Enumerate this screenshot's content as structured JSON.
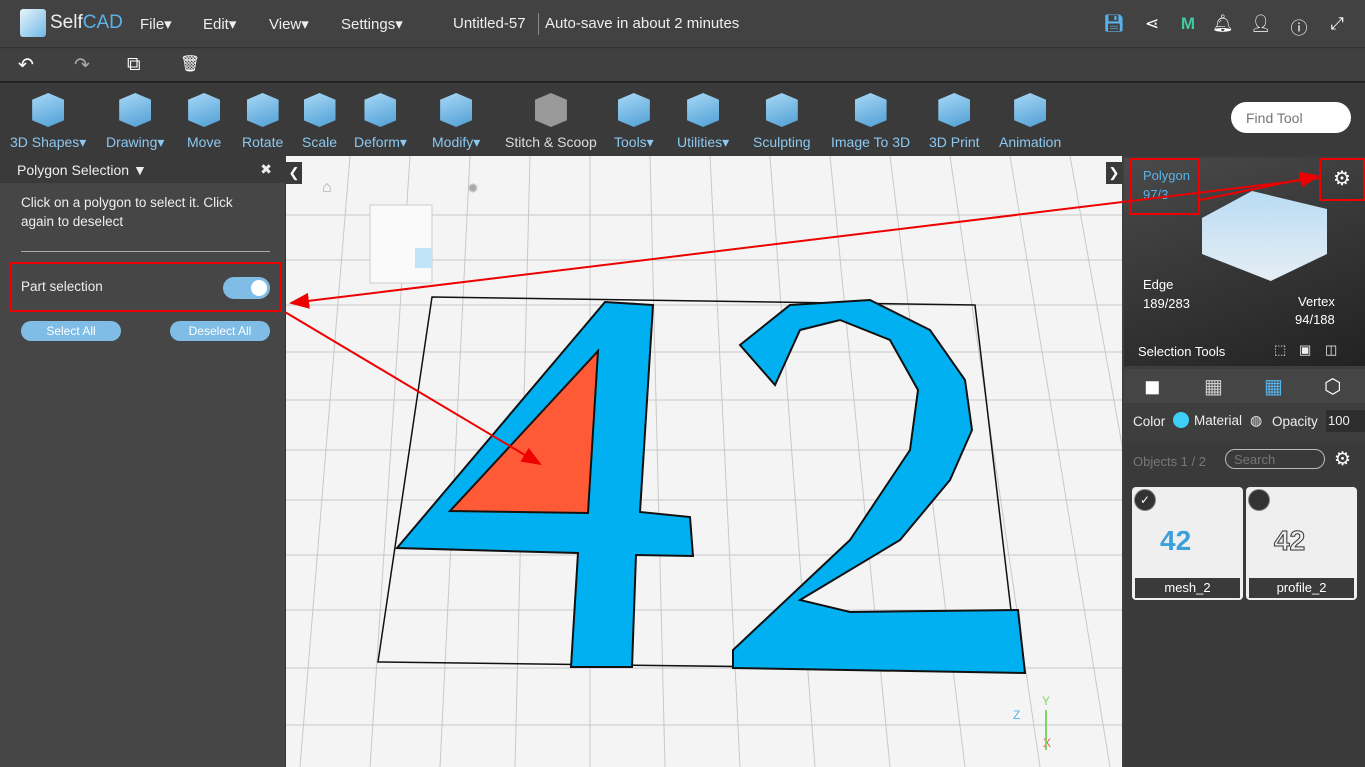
{
  "app": {
    "logo_a": "Self",
    "logo_b": "CAD",
    "menus": [
      "File▾",
      "Edit▾",
      "View▾",
      "Settings▾"
    ],
    "doc_title": "Untitled-57",
    "autosave": "Auto-save in about 2 minutes"
  },
  "header_icons": [
    "save-icon",
    "share-icon",
    "m-icon",
    "bell-icon",
    "user-icon",
    "info-icon",
    "fullscreen-icon"
  ],
  "edit_row": {
    "undo": "↶",
    "redo": "↷",
    "copy": "⧉",
    "delete": "🗑"
  },
  "tools": [
    "3D Shapes▾",
    "Drawing▾",
    "Move",
    "Rotate",
    "Scale",
    "Deform▾",
    "Modify▾",
    "Stitch & Scoop",
    "Tools▾",
    "Utilities▾",
    "Sculpting",
    "Image To 3D",
    "3D Print",
    "Animation"
  ],
  "find_tool_placeholder": "Find Tool",
  "left_panel": {
    "title": "Polygon Selection ▼",
    "close": "✖",
    "instructions": "Click on a polygon to select it. Click again to deselect",
    "part_selection": "Part selection",
    "part_selection_on": true,
    "select_all": "Select All",
    "deselect_all": "Deselect All"
  },
  "right_panel": {
    "polygon": "Polygon",
    "polygon_count": "97/3",
    "edge": "Edge",
    "edge_count": "189/283",
    "vertex": "Vertex",
    "vertex_count": "94/188",
    "selection_tools": "Selection Tools",
    "color": "Color",
    "material": "Material",
    "opacity": "Opacity",
    "opacity_value": "100",
    "objects": "Objects 1 / 2",
    "search_placeholder": "Search",
    "objects_list": [
      {
        "name": "mesh_2",
        "checked": true
      },
      {
        "name": "profile_2",
        "checked": false
      }
    ]
  },
  "colors": {
    "accent": "#59b3ea",
    "shape": "#00b0f0",
    "selected_polygon": "#ff5a36",
    "annotation": "#e00000"
  },
  "axes": {
    "y": "Y",
    "z": "Z",
    "x": "X"
  }
}
